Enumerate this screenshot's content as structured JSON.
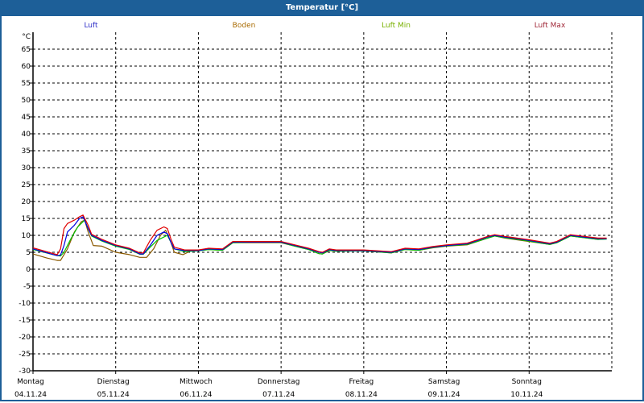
{
  "window": {
    "title": "Temperatur [°C]"
  },
  "chart_data": {
    "type": "line",
    "title": "Temperatur [°C]",
    "ylabel": "°C",
    "ylim": [
      -30,
      65
    ],
    "yticks": [
      65,
      60,
      55,
      50,
      45,
      40,
      35,
      30,
      25,
      20,
      15,
      10,
      5,
      0,
      -5,
      -10,
      -15,
      -20,
      -25,
      -30
    ],
    "xlim_hours": [
      0,
      168
    ],
    "grid": true,
    "legend_placement": "top",
    "x_days": [
      {
        "day": "Montag",
        "date": "04.11.24"
      },
      {
        "day": "Dienstag",
        "date": "05.11.24"
      },
      {
        "day": "Mittwoch",
        "date": "06.11.24"
      },
      {
        "day": "Donnerstag",
        "date": "07.11.24"
      },
      {
        "day": "Freitag",
        "date": "08.11.24"
      },
      {
        "day": "Samstag",
        "date": "09.11.24"
      },
      {
        "day": "Sonntag",
        "date": "10.11.24"
      }
    ],
    "series": [
      {
        "name": "Boden",
        "color": "#8b5a00",
        "legend_color": "#a86a00",
        "points": [
          [
            0,
            4.5
          ],
          [
            4,
            3.3
          ],
          [
            7,
            2.6
          ],
          [
            8,
            2.6
          ],
          [
            10,
            6
          ],
          [
            12,
            11
          ],
          [
            14,
            14
          ],
          [
            15,
            14.5
          ],
          [
            16,
            11
          ],
          [
            17.5,
            7
          ],
          [
            20,
            6.8
          ],
          [
            24,
            5
          ],
          [
            28,
            4.3
          ],
          [
            31,
            3.5
          ],
          [
            33,
            3.5
          ],
          [
            35,
            6
          ],
          [
            37,
            10
          ],
          [
            38.5,
            11.5
          ],
          [
            40,
            8
          ],
          [
            41,
            5
          ],
          [
            43.5,
            4.3
          ],
          [
            46,
            5.5
          ],
          [
            48,
            5.5
          ],
          [
            51,
            5.8
          ],
          [
            55,
            5.6
          ],
          [
            58,
            7.8
          ],
          [
            64,
            7.8
          ],
          [
            72,
            7.8
          ],
          [
            76,
            6.8
          ],
          [
            80,
            5.8
          ],
          [
            83,
            4.6
          ],
          [
            84,
            4.5
          ],
          [
            86,
            5.5
          ],
          [
            88,
            5.3
          ],
          [
            96,
            5.4
          ],
          [
            104,
            4.8
          ],
          [
            108,
            5.8
          ],
          [
            112,
            5.6
          ],
          [
            116,
            6.3
          ],
          [
            120,
            6.8
          ],
          [
            126,
            7.2
          ],
          [
            132,
            9.2
          ],
          [
            134,
            9.8
          ],
          [
            137,
            9.2
          ],
          [
            144,
            8.2
          ],
          [
            150,
            7.3
          ],
          [
            152,
            7.8
          ],
          [
            156,
            9.8
          ],
          [
            160,
            9.3
          ],
          [
            164,
            8.8
          ],
          [
            166.5,
            9
          ]
        ]
      },
      {
        "name": "Luft Min",
        "color": "#00c000",
        "legend_color": "#78b000",
        "points": [
          [
            0,
            5.8
          ],
          [
            7,
            4
          ],
          [
            8,
            3.9
          ],
          [
            9,
            5
          ],
          [
            11,
            9
          ],
          [
            13,
            12.5
          ],
          [
            15,
            14.5
          ],
          [
            16,
            12
          ],
          [
            17,
            9.8
          ],
          [
            20,
            8.3
          ],
          [
            24,
            6.8
          ],
          [
            28,
            5.8
          ],
          [
            31,
            4.4
          ],
          [
            32,
            4.4
          ],
          [
            34,
            6.5
          ],
          [
            36,
            8.5
          ],
          [
            38,
            9.5
          ],
          [
            39,
            10
          ],
          [
            40,
            8
          ],
          [
            41,
            6
          ],
          [
            44,
            5.2
          ],
          [
            48,
            5.4
          ],
          [
            51,
            5.8
          ],
          [
            55,
            5.6
          ],
          [
            58,
            7.8
          ],
          [
            64,
            8
          ],
          [
            72,
            7.9
          ],
          [
            76,
            6.8
          ],
          [
            80,
            5.8
          ],
          [
            83,
            4.6
          ],
          [
            84,
            4.5
          ],
          [
            86,
            5.6
          ],
          [
            88,
            5.3
          ],
          [
            96,
            5.4
          ],
          [
            104,
            4.8
          ],
          [
            108,
            5.8
          ],
          [
            112,
            5.6
          ],
          [
            116,
            6.4
          ],
          [
            120,
            6.9
          ],
          [
            126,
            7.3
          ],
          [
            132,
            9.2
          ],
          [
            134,
            9.8
          ],
          [
            137,
            9.3
          ],
          [
            144,
            8.3
          ],
          [
            150,
            7.3
          ],
          [
            152,
            7.8
          ],
          [
            156,
            9.8
          ],
          [
            160,
            9.3
          ],
          [
            164,
            8.8
          ],
          [
            166.5,
            8.9
          ]
        ]
      },
      {
        "name": "Luft",
        "color": "#0000e0",
        "legend_color": "#3030c8",
        "points": [
          [
            0,
            6
          ],
          [
            7,
            4
          ],
          [
            8,
            4.2
          ],
          [
            9,
            7
          ],
          [
            10,
            11
          ],
          [
            12,
            13
          ],
          [
            13.5,
            15
          ],
          [
            14.5,
            15.5
          ],
          [
            16,
            12
          ],
          [
            17,
            10
          ],
          [
            20,
            8.5
          ],
          [
            24,
            7
          ],
          [
            28,
            6
          ],
          [
            31,
            4.5
          ],
          [
            32,
            4.5
          ],
          [
            34,
            7
          ],
          [
            36,
            10
          ],
          [
            38,
            11
          ],
          [
            39,
            10.5
          ],
          [
            40,
            8
          ],
          [
            41,
            6
          ],
          [
            44,
            5.5
          ],
          [
            48,
            5.5
          ],
          [
            51,
            6
          ],
          [
            55,
            5.8
          ],
          [
            58,
            8
          ],
          [
            64,
            8
          ],
          [
            72,
            8
          ],
          [
            76,
            7
          ],
          [
            80,
            6
          ],
          [
            83,
            5
          ],
          [
            84,
            4.8
          ],
          [
            86,
            5.8
          ],
          [
            88,
            5.5
          ],
          [
            96,
            5.5
          ],
          [
            104,
            5
          ],
          [
            108,
            6
          ],
          [
            112,
            5.8
          ],
          [
            116,
            6.5
          ],
          [
            120,
            7
          ],
          [
            126,
            7.5
          ],
          [
            132,
            9.5
          ],
          [
            134,
            10
          ],
          [
            137,
            9.5
          ],
          [
            144,
            8.5
          ],
          [
            150,
            7.5
          ],
          [
            152,
            8
          ],
          [
            156,
            10
          ],
          [
            160,
            9.5
          ],
          [
            164,
            9
          ],
          [
            166.5,
            9
          ]
        ]
      },
      {
        "name": "Luft Max",
        "color": "#e00000",
        "legend_color": "#a02838",
        "points": [
          [
            0,
            6.3
          ],
          [
            7,
            4.3
          ],
          [
            8,
            6
          ],
          [
            9,
            12
          ],
          [
            10,
            13.5
          ],
          [
            12,
            14.5
          ],
          [
            13.5,
            15.5
          ],
          [
            14.5,
            16
          ],
          [
            16,
            13
          ],
          [
            17,
            10.3
          ],
          [
            20,
            8.8
          ],
          [
            24,
            7.2
          ],
          [
            28,
            6.2
          ],
          [
            31,
            4.8
          ],
          [
            32,
            4.8
          ],
          [
            34,
            8.5
          ],
          [
            36,
            11.5
          ],
          [
            38,
            12.5
          ],
          [
            39,
            12
          ],
          [
            40,
            9
          ],
          [
            41,
            6.5
          ],
          [
            44,
            5.7
          ],
          [
            48,
            5.7
          ],
          [
            51,
            6.2
          ],
          [
            55,
            6
          ],
          [
            58,
            8.2
          ],
          [
            64,
            8.2
          ],
          [
            72,
            8.2
          ],
          [
            76,
            7.2
          ],
          [
            80,
            6.2
          ],
          [
            83,
            5.2
          ],
          [
            84,
            5
          ],
          [
            86,
            6
          ],
          [
            88,
            5.7
          ],
          [
            96,
            5.7
          ],
          [
            104,
            5.2
          ],
          [
            108,
            6.2
          ],
          [
            112,
            6
          ],
          [
            116,
            6.7
          ],
          [
            120,
            7.2
          ],
          [
            126,
            7.7
          ],
          [
            132,
            9.7
          ],
          [
            134,
            10.2
          ],
          [
            137,
            9.7
          ],
          [
            144,
            8.7
          ],
          [
            150,
            7.7
          ],
          [
            152,
            8.2
          ],
          [
            156,
            10.2
          ],
          [
            160,
            9.7
          ],
          [
            164,
            9.2
          ],
          [
            166.5,
            9.2
          ]
        ]
      }
    ]
  }
}
